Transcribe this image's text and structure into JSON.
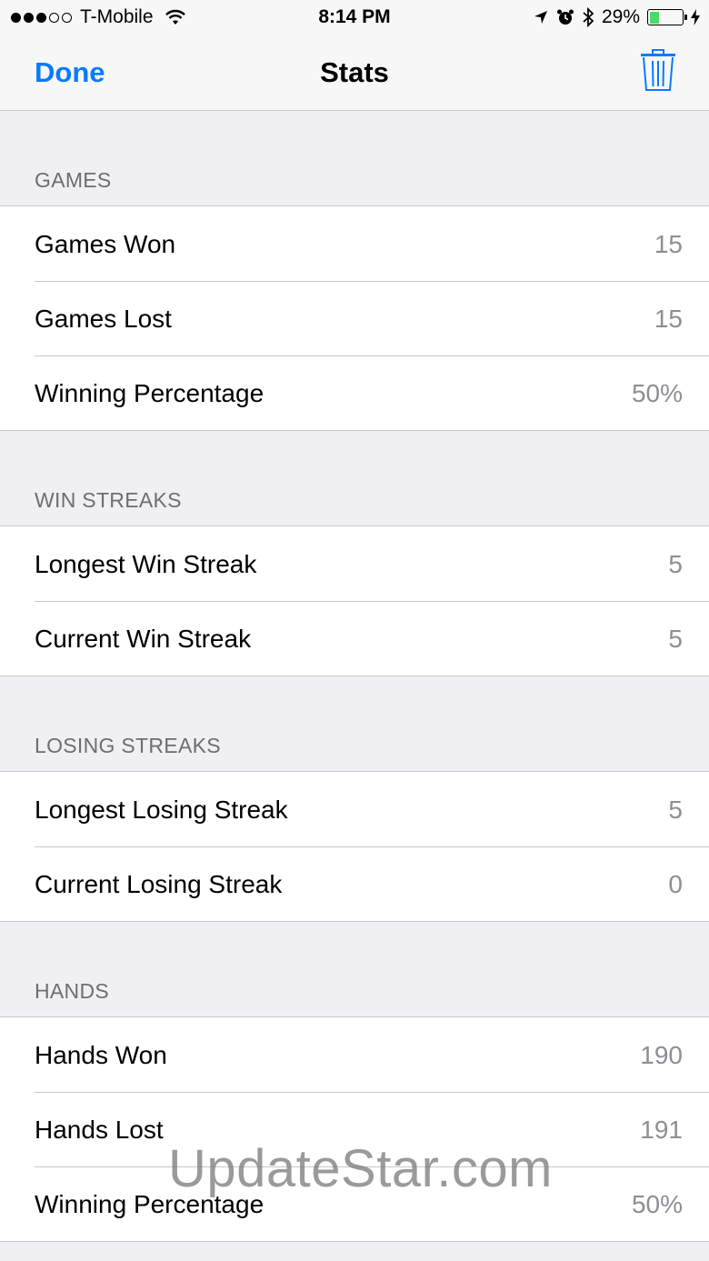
{
  "status_bar": {
    "carrier": "T-Mobile",
    "time": "8:14 PM",
    "battery_percent": "29%",
    "battery_level": 0.29,
    "signal_bars": 3,
    "icons": [
      "wifi-icon",
      "location-arrow-icon",
      "alarm-icon",
      "bluetooth-icon",
      "battery-icon",
      "charging-bolt-icon"
    ]
  },
  "nav": {
    "done_label": "Done",
    "title": "Stats",
    "trash_icon": "trash-icon",
    "accent_color": "#0a7aff"
  },
  "sections": [
    {
      "header": "GAMES",
      "rows": [
        {
          "label": "Games Won",
          "value": "15"
        },
        {
          "label": "Games Lost",
          "value": "15"
        },
        {
          "label": "Winning Percentage",
          "value": "50%"
        }
      ]
    },
    {
      "header": "WIN STREAKS",
      "rows": [
        {
          "label": "Longest Win Streak",
          "value": "5"
        },
        {
          "label": "Current Win Streak",
          "value": "5"
        }
      ]
    },
    {
      "header": "LOSING STREAKS",
      "rows": [
        {
          "label": "Longest Losing Streak",
          "value": "5"
        },
        {
          "label": "Current Losing Streak",
          "value": "0"
        }
      ]
    },
    {
      "header": "HANDS",
      "rows": [
        {
          "label": "Hands Won",
          "value": "190"
        },
        {
          "label": "Hands Lost",
          "value": "191"
        },
        {
          "label": "Winning Percentage",
          "value": "50%"
        }
      ]
    }
  ],
  "watermark": "UpdateStar.com"
}
